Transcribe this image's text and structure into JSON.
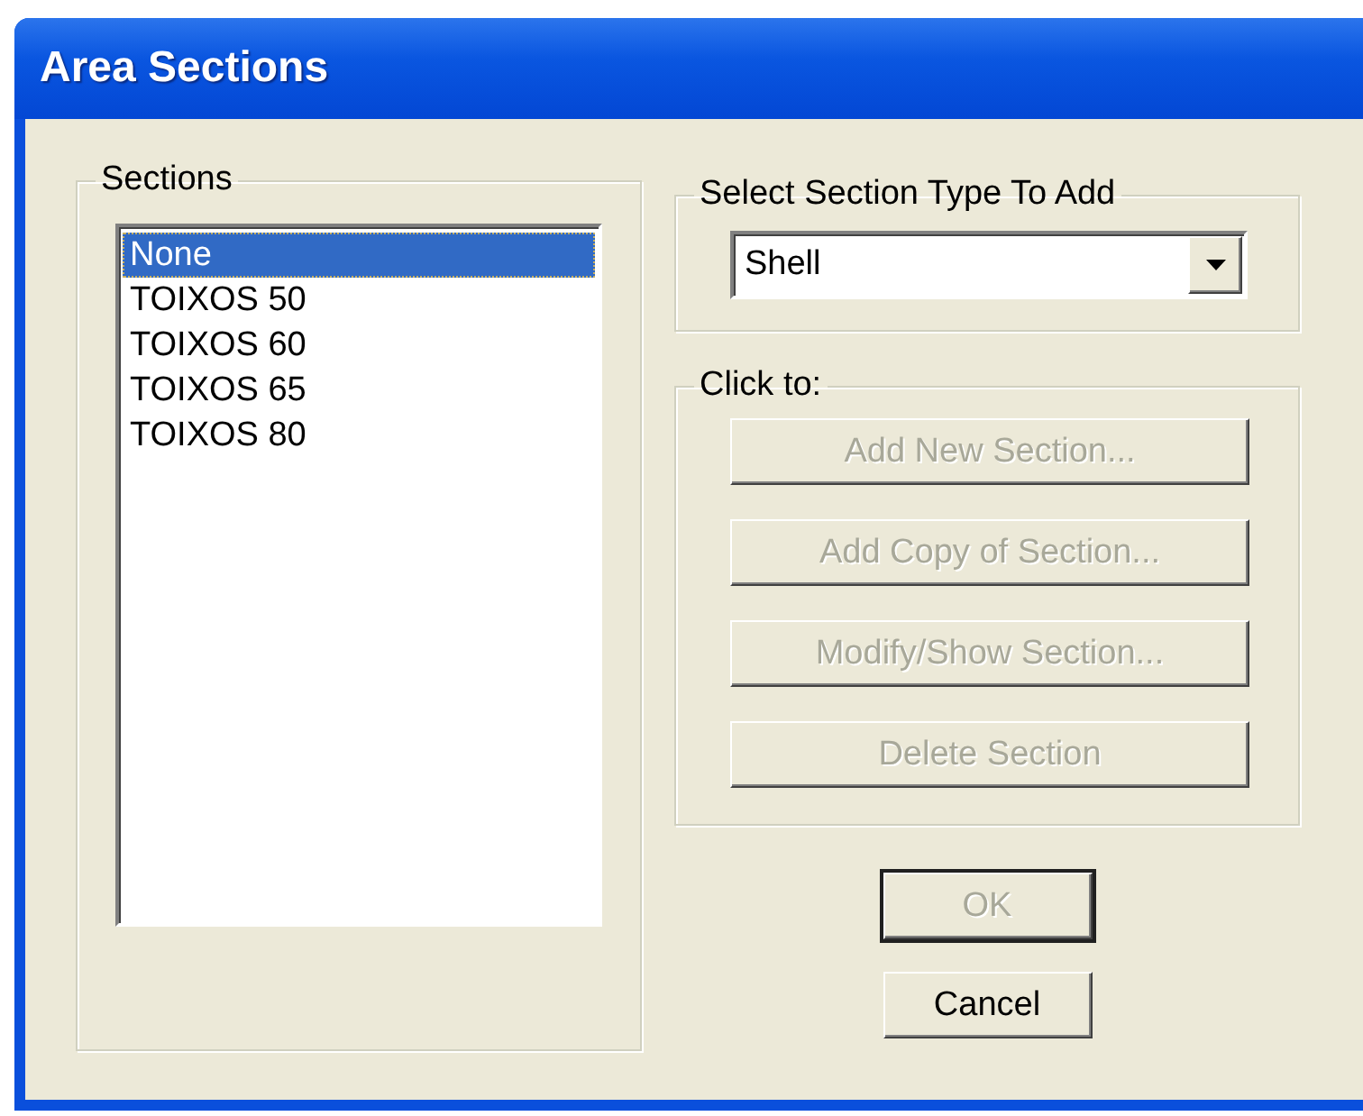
{
  "window": {
    "title": "Area Sections"
  },
  "sections": {
    "label": "Sections",
    "items": [
      {
        "label": "None",
        "selected": true
      },
      {
        "label": "TOIXOS 50",
        "selected": false
      },
      {
        "label": "TOIXOS 60",
        "selected": false
      },
      {
        "label": "TOIXOS 65",
        "selected": false
      },
      {
        "label": "TOIXOS 80",
        "selected": false
      }
    ]
  },
  "section_type": {
    "label": "Select Section Type To Add",
    "value": "Shell"
  },
  "actions": {
    "label": "Click to:",
    "buttons": [
      {
        "label": "Add New Section...",
        "disabled": true
      },
      {
        "label": "Add Copy of Section...",
        "disabled": true
      },
      {
        "label": "Modify/Show Section...",
        "disabled": true
      },
      {
        "label": "Delete Section",
        "disabled": true
      }
    ]
  },
  "buttons": [
    {
      "label": "OK",
      "disabled": true,
      "default": true
    },
    {
      "label": "Cancel",
      "disabled": false,
      "default": false
    }
  ]
}
